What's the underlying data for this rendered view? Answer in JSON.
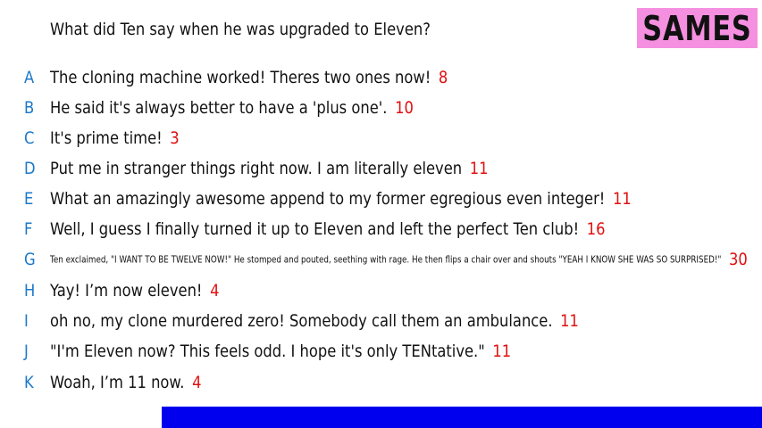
{
  "question": "What did Ten say when he was upgraded to Eleven?",
  "badge": "SAMES",
  "answers": [
    {
      "letter": "A",
      "text": "The cloning machine worked! Theres two ones now!",
      "score": "8"
    },
    {
      "letter": "B",
      "text": "He said it's always better to have a 'plus one'.",
      "score": "10"
    },
    {
      "letter": "C",
      "text": "It's prime time!",
      "score": "3"
    },
    {
      "letter": "D",
      "text": "Put me in stranger things right now. I am literally eleven",
      "score": "11"
    },
    {
      "letter": "E",
      "text": "What an amazingly awesome append to my former egregious even integer!",
      "score": "11"
    },
    {
      "letter": "F",
      "text": "Well, I guess I finally turned it up to Eleven and left the perfect Ten club!",
      "score": "16"
    },
    {
      "letter": "G",
      "text": "Ten exclaimed, \"I WANT TO BE TWELVE NOW!\" He stomped and pouted, seething with rage. He then flips a chair over and shouts \"YEAH I KNOW SHE WAS SO SURPRISED!\"",
      "score": "30"
    },
    {
      "letter": "H",
      "text": "Yay! I’m now eleven!",
      "score": "4"
    },
    {
      "letter": "I",
      "text": "oh no, my clone murdered zero! Somebody call them an ambulance.",
      "score": "11"
    },
    {
      "letter": "J",
      "text": "\"I'm Eleven now? This feels odd. I hope it's only TENtative.\"",
      "score": "11"
    },
    {
      "letter": "K",
      "text": "Woah, I’m 11 now.",
      "score": "4"
    }
  ],
  "colors": {
    "letter": "#1c78c8",
    "score": "#e01010",
    "badge_bg": "#f58fe0",
    "footer_bar": "#0000ee"
  }
}
